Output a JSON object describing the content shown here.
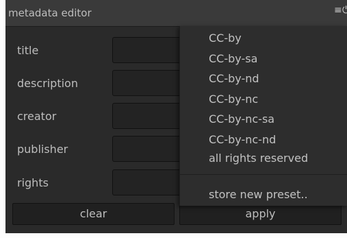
{
  "header": {
    "title": "metadata editor",
    "icons": [
      "menu-icon",
      "reset-icon"
    ],
    "menu_glyph": "≡",
    "reset_glyph": "⏻"
  },
  "fields": [
    {
      "label": "title",
      "value": ""
    },
    {
      "label": "description",
      "value": ""
    },
    {
      "label": "creator",
      "value": ""
    },
    {
      "label": "publisher",
      "value": ""
    },
    {
      "label": "rights",
      "value": ""
    }
  ],
  "buttons": {
    "clear": "clear",
    "apply": "apply"
  },
  "presets_menu": {
    "items": [
      "CC-by",
      "CC-by-sa",
      "CC-by-nd",
      "CC-by-nc",
      "CC-by-nc-sa",
      "CC-by-nc-nd",
      "all rights reserved"
    ],
    "store_label": "store new preset.."
  },
  "colors": {
    "panel_bg": "#2a2a2a",
    "header_bg": "#3a3a3a",
    "text": "#bdbdbd",
    "input_bg": "#232323",
    "menu_bg": "#2d2d2d"
  }
}
